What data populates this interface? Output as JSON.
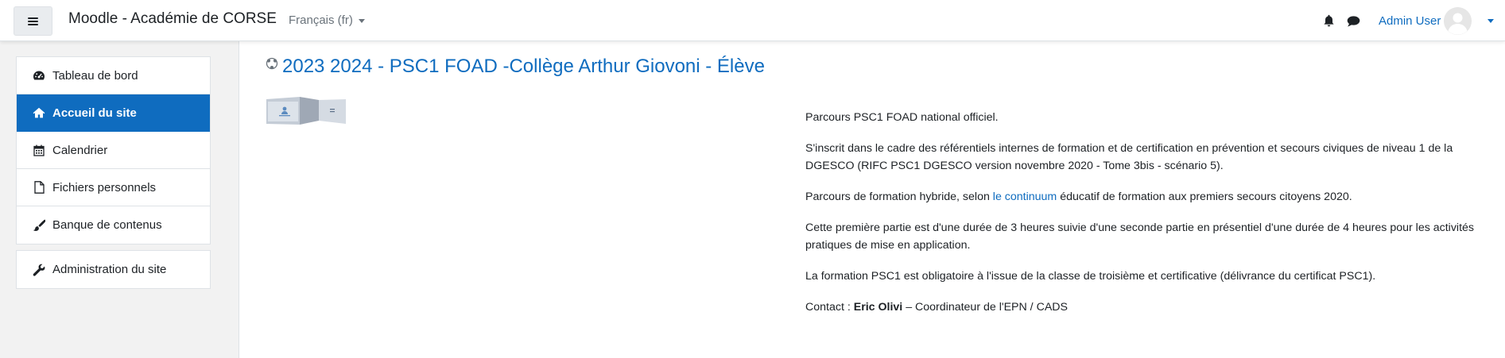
{
  "navbar": {
    "site_name": "Moodle - Académie de CORSE",
    "language": "Français (fr)",
    "user_name": "Admin User"
  },
  "sidebar": {
    "items": [
      {
        "label": "Tableau de bord",
        "icon": "tachometer-icon"
      },
      {
        "label": "Accueil du site",
        "icon": "home-icon",
        "active": true
      },
      {
        "label": "Calendrier",
        "icon": "calendar-icon"
      },
      {
        "label": "Fichiers personnels",
        "icon": "file-icon"
      },
      {
        "label": "Banque de contenus",
        "icon": "paint-brush-icon"
      }
    ],
    "admin_item": {
      "label": "Administration du site",
      "icon": "wrench-icon"
    }
  },
  "course": {
    "title": "2023 2024 - PSC1 FOAD -Collège Arthur Giovoni - Élève",
    "summary": {
      "p1": "Parcours PSC1 FOAD national officiel.",
      "p2": "S'inscrit dans le cadre des référentiels internes de formation et de certification en prévention et secours civiques de niveau 1 de la DGESCO (RIFC PSC1 DGESCO version novembre 2020 - Tome 3bis - scénario 5).",
      "p3_before": "Parcours de formation hybride, selon ",
      "p3_link": "le continuum",
      "p3_after": " éducatif de formation aux premiers secours citoyens 2020.",
      "p4": "Cette première partie est d'une durée de 3 heures suivie d'une seconde partie en présentiel d'une durée de 4 heures pour les activités pratiques de mise en application.",
      "p5": "La formation PSC1 est obligatoire à l'issue de la classe de troisième et certificative (délivrance du certificat PSC1).",
      "contact_label": "Contact : ",
      "contact_name": "Eric Olivi",
      "contact_role": " – Coordinateur de l'EPN / CADS"
    }
  },
  "colors": {
    "primary": "#0f6cbf",
    "drawer_bg": "#f2f2f2",
    "text": "#1d2125"
  }
}
